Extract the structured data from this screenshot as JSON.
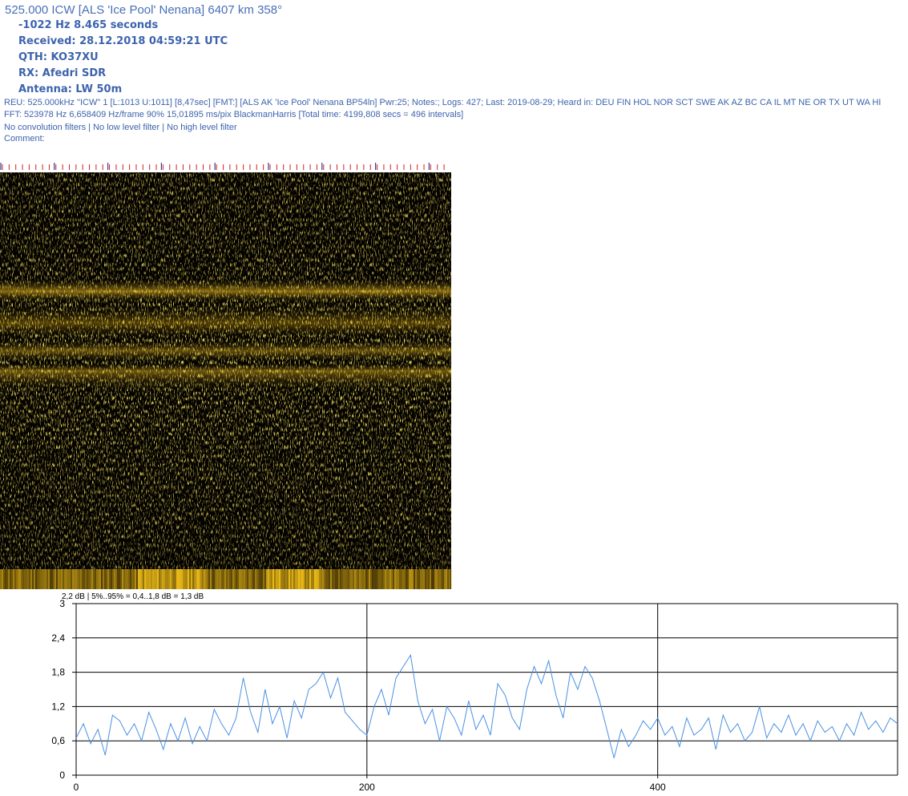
{
  "header": {
    "title": "525.000 ICW [ALS 'Ice Pool'  Nenana] 6407 km 358°",
    "offset_line": "-1022 Hz 8.465 seconds",
    "received": "Received: 28.12.2018 04:59:21 UTC",
    "qth": "QTH: KO37XU",
    "rx": "RX: Afedri SDR",
    "antenna": "Antenna: LW 50m"
  },
  "info": {
    "reu": "REU: 525.000kHz \"ICW\" 1 [L:1013 U:1011] [8,47sec] [FMT:] [ALS AK 'Ice Pool'  Nenana BP54ln] Pwr:25; Notes:; Logs: 427; Last: 2019-08-29; Heard in: DEU FIN HOL NOR SCT SWE AK AZ BC CA IL MT NE OR TX UT WA HI",
    "fft": "FFT: 523978 Hz 6,658409 Hz/frame 90% 15,01895 ms/pix BlackmanHarris [Total time: 4199,808 secs = 496 intervals]",
    "filters": "No convolution filters | No low level filter | No high level filter",
    "comment": "Comment:"
  },
  "colors": {
    "text": "#3d63ad",
    "series": "#4a90e2",
    "spectrogram_signal": "#e8b818",
    "tick_red": "#d02020"
  },
  "chart_data": {
    "type": "line",
    "caption": "2,2 dB | 5%..95% = 0,4..1,8 dB = 1,3 dB",
    "ylim": [
      0,
      3
    ],
    "xlim": [
      0,
      565
    ],
    "yticks": [
      0,
      0.6,
      1.2,
      1.8,
      2.4,
      3
    ],
    "ytick_labels": [
      "0",
      "0,6",
      "1,2",
      "1,8",
      "2,4",
      "3"
    ],
    "xticks": [
      0,
      200,
      400
    ],
    "xtick_labels": [
      "0",
      "200",
      "400"
    ],
    "grid": true,
    "series": [
      {
        "x": [
          0,
          5,
          10,
          15,
          20,
          25,
          30,
          35,
          40,
          45,
          50,
          55,
          60,
          65,
          70,
          75,
          80,
          85,
          90,
          95,
          100,
          105,
          110,
          115,
          120,
          125,
          130,
          135,
          140,
          145,
          150,
          155,
          160,
          165,
          170,
          175,
          180,
          185,
          190,
          195,
          200,
          205,
          210,
          215,
          220,
          225,
          230,
          235,
          240,
          245,
          250,
          255,
          260,
          265,
          270,
          275,
          280,
          285,
          290,
          295,
          300,
          305,
          310,
          315,
          320,
          325,
          330,
          335,
          340,
          345,
          350,
          355,
          360,
          365,
          370,
          375,
          380,
          385,
          390,
          395,
          400,
          405,
          410,
          415,
          420,
          425,
          430,
          435,
          440,
          445,
          450,
          455,
          460,
          465,
          470,
          475,
          480,
          485,
          490,
          495,
          500,
          505,
          510,
          515,
          520,
          525,
          530,
          535,
          540,
          545,
          550,
          555,
          560,
          565
        ],
        "values": [
          0.65,
          0.9,
          0.55,
          0.8,
          0.35,
          1.05,
          0.95,
          0.7,
          0.9,
          0.6,
          1.1,
          0.8,
          0.45,
          0.9,
          0.6,
          1.0,
          0.55,
          0.85,
          0.6,
          1.15,
          0.9,
          0.7,
          1.0,
          1.7,
          1.1,
          0.75,
          1.5,
          0.9,
          1.2,
          0.65,
          1.3,
          1.0,
          1.5,
          1.6,
          1.8,
          1.35,
          1.7,
          1.1,
          0.95,
          0.8,
          0.7,
          1.2,
          1.5,
          1.05,
          1.7,
          1.9,
          2.1,
          1.3,
          0.9,
          1.15,
          0.6,
          1.2,
          1.0,
          0.7,
          1.3,
          0.8,
          1.05,
          0.7,
          1.6,
          1.4,
          1.0,
          0.8,
          1.5,
          1.9,
          1.6,
          2.0,
          1.4,
          1.0,
          1.8,
          1.5,
          1.9,
          1.7,
          1.3,
          0.8,
          0.3,
          0.8,
          0.5,
          0.7,
          0.95,
          0.8,
          1.0,
          0.7,
          0.85,
          0.5,
          1.0,
          0.7,
          0.8,
          1.0,
          0.45,
          1.05,
          0.75,
          0.9,
          0.6,
          0.75,
          1.2,
          0.65,
          0.9,
          0.75,
          1.05,
          0.7,
          0.9,
          0.6,
          0.95,
          0.75,
          0.85,
          0.6,
          0.9,
          0.7,
          1.1,
          0.8,
          0.95,
          0.75,
          1.0,
          0.9
        ]
      }
    ]
  }
}
